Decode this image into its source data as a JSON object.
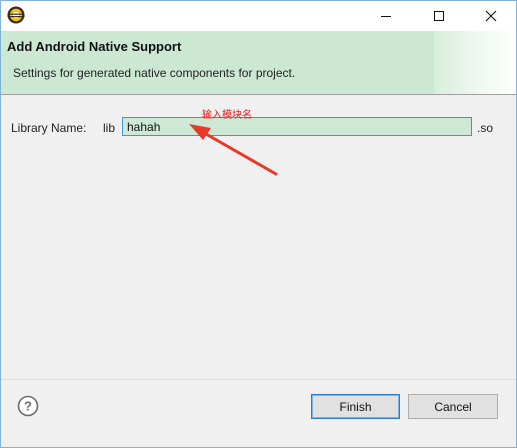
{
  "titlebar": {
    "app_icon": "eclipse-icon",
    "minimize_icon": "minimize-icon",
    "maximize_icon": "maximize-icon",
    "close_icon": "close-icon"
  },
  "banner": {
    "title": "Add Android Native Support",
    "subtitle": "Settings for generated native components for project."
  },
  "form": {
    "library_label": "Library Name:",
    "prefix": "lib",
    "library_value": "hahah",
    "suffix": ".so"
  },
  "annotation": {
    "text": "输入模块名",
    "color": "#e02020"
  },
  "footer": {
    "help_icon": "help-icon",
    "finish_label": "Finish",
    "cancel_label": "Cancel"
  },
  "colors": {
    "banner": "#cce8d3",
    "input_bg": "#cde9d6",
    "focus_border": "#2a79d2"
  }
}
